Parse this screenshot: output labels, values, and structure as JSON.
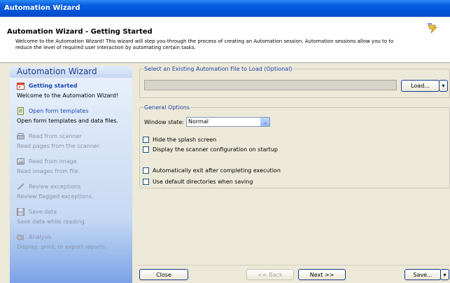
{
  "window": {
    "title": "Automation Wizard"
  },
  "header": {
    "title": "Automation Wizard - Getting Started",
    "description": "Welcome to the Automation Wizard! This wizard will step you through the process of creating an Automation session. Automation sessions allow you to to reduce the level of required user interaction by automating certain tasks."
  },
  "sidebar": {
    "title": "Automation Wizard",
    "steps": [
      {
        "title": "Getting started",
        "desc": "Welcome to the Automation Wizard!",
        "state": "active",
        "icon": "getting-started-icon"
      },
      {
        "title": "Open form templates",
        "desc": "Open form templates and data files.",
        "state": "enabled",
        "icon": "form-template-icon"
      },
      {
        "title": "Read from scanner",
        "desc": "Read pages from the scanner.",
        "state": "disabled",
        "icon": "scanner-icon"
      },
      {
        "title": "Read from image",
        "desc": "Read images from file.",
        "state": "disabled",
        "icon": "image-icon"
      },
      {
        "title": "Review exceptions",
        "desc": "Review flagged exceptions.",
        "state": "disabled",
        "icon": "review-icon"
      },
      {
        "title": "Save data",
        "desc": "Save data while reading.",
        "state": "disabled",
        "icon": "save-icon"
      },
      {
        "title": "Analysis",
        "desc": "Display, print, or export reports.",
        "state": "disabled",
        "icon": "analysis-icon"
      }
    ]
  },
  "load_group": {
    "legend": "Select an Existing Automation File to Load (Optional)",
    "file_value": "",
    "load_label": "Load..."
  },
  "options_group": {
    "legend": "General Options",
    "window_state_label": "Window state:",
    "window_state_value": "Normal",
    "checkboxes": [
      {
        "label": "Hide the splash screen",
        "checked": false
      },
      {
        "label": "Display the scanner configuration on startup",
        "checked": false
      },
      {
        "label": "Automatically exit after completing execution",
        "checked": false
      },
      {
        "label": "Use default directories when saving",
        "checked": false
      }
    ]
  },
  "footer": {
    "close_label": "Close",
    "back_label": "<< Back",
    "next_label": "Next >>",
    "save_label": "Save..."
  }
}
